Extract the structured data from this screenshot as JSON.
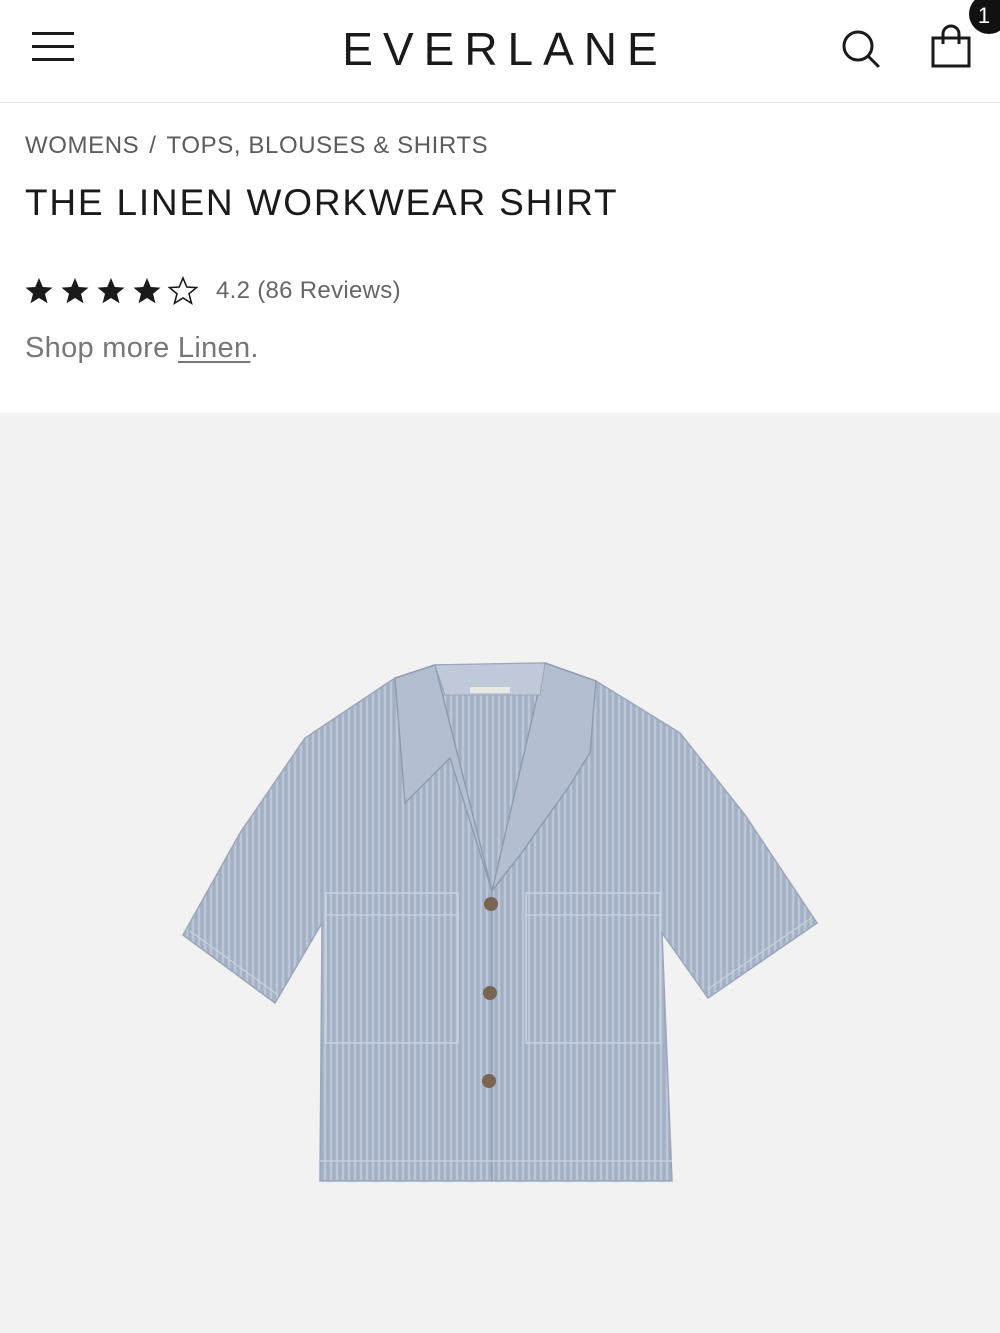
{
  "header": {
    "logo": "EVERLANE",
    "cart_count": "1",
    "icons": {
      "menu": "hamburger-menu-icon",
      "search": "search-icon",
      "cart": "shopping-bag-icon"
    }
  },
  "breadcrumb": {
    "items": [
      "WOMENS",
      "TOPS, BLOUSES & SHIRTS"
    ],
    "separator": "/"
  },
  "product": {
    "title": "THE LINEN WORKWEAR SHIRT",
    "rating_value": 4.2,
    "rating_max": 5,
    "rating_text": "4.2 (86 Reviews)",
    "shop_more_prefix": "Shop more ",
    "shop_more_link": "Linen",
    "shop_more_suffix": "."
  },
  "colors": {
    "text": "#1a1a1a",
    "muted": "#666666",
    "image_bg": "#f2f2f2",
    "shirt": "#a9b5c8",
    "badge": "#111111"
  }
}
